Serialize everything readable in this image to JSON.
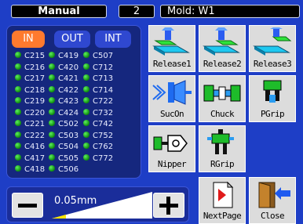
{
  "header": {
    "mode": "Manual",
    "step": "2",
    "mold": "Mold: W1"
  },
  "io": {
    "tabs": [
      "IN",
      "OUT",
      "INT"
    ],
    "active_tab": "IN",
    "led_color": "#2ecc2e",
    "rows": [
      [
        "C215",
        "C419",
        "C507"
      ],
      [
        "C216",
        "C420",
        "C712"
      ],
      [
        "C217",
        "C421",
        "C713"
      ],
      [
        "C218",
        "C422",
        "C714"
      ],
      [
        "C219",
        "C423",
        "C722"
      ],
      [
        "C220",
        "C424",
        "C732"
      ],
      [
        "C221",
        "C502",
        "C742"
      ],
      [
        "C222",
        "C503",
        "C752"
      ],
      [
        "C416",
        "C504",
        "C762"
      ],
      [
        "C417",
        "C505",
        "C772"
      ],
      [
        "C418",
        "C506",
        ""
      ]
    ]
  },
  "jog": {
    "step_value": "0.05mm",
    "minus_icon": "minus-icon",
    "plus_icon": "plus-icon"
  },
  "actions": {
    "release1": "Release1",
    "release2": "Release2",
    "release3": "Release3",
    "sucon": "SucOn",
    "chuck": "Chuck",
    "pgrip": "PGrip",
    "nipper": "Nipper",
    "rgrip": "RGrip",
    "nextpage": "NextPage",
    "close": "Close"
  },
  "colors": {
    "background": "#1e3ec6",
    "accent": "#ff7a2e",
    "panel": "#15277e"
  }
}
